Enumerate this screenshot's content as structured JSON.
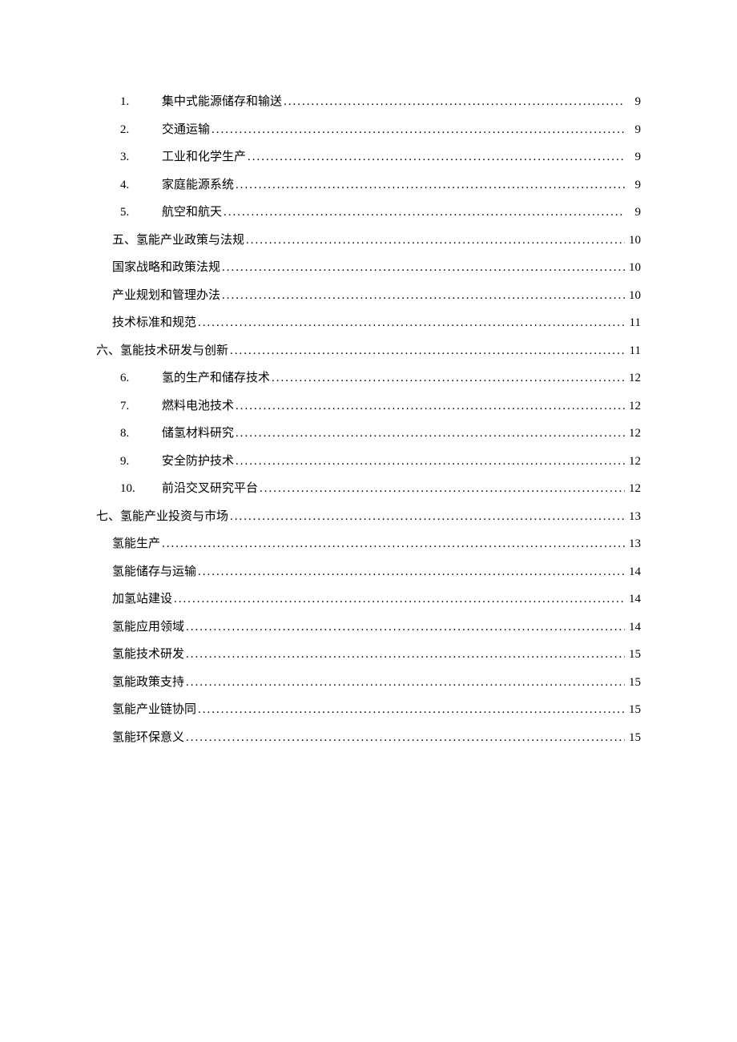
{
  "entries": [
    {
      "indent": 2,
      "num": "1.",
      "title": "集中式能源储存和输送",
      "page": "9"
    },
    {
      "indent": 2,
      "num": "2.",
      "title": "交通运输",
      "page": "9"
    },
    {
      "indent": 2,
      "num": "3.",
      "title": "工业和化学生产",
      "page": "9"
    },
    {
      "indent": 2,
      "num": "4.",
      "title": "家庭能源系统",
      "page": "9"
    },
    {
      "indent": 2,
      "num": "5.",
      "title": "航空和航天",
      "page": "9"
    },
    {
      "indent": 1,
      "num": "",
      "title": "五、氢能产业政策与法规",
      "page": "10"
    },
    {
      "indent": 1,
      "num": "",
      "title": "国家战略和政策法规",
      "page": "10"
    },
    {
      "indent": 1,
      "num": "",
      "title": "产业规划和管理办法",
      "page": "10"
    },
    {
      "indent": 1,
      "num": "",
      "title": "技术标准和规范",
      "page": "11"
    },
    {
      "indent": 0,
      "num": "",
      "title": "六、氢能技术研发与创新",
      "page": "11"
    },
    {
      "indent": 2,
      "num": "6.",
      "title": "氢的生产和储存技术",
      "page": "12"
    },
    {
      "indent": 2,
      "num": "7.",
      "title": "燃料电池技术",
      "page": "12"
    },
    {
      "indent": 2,
      "num": "8.",
      "title": "储氢材料研究",
      "page": "12"
    },
    {
      "indent": 2,
      "num": "9.",
      "title": "安全防护技术",
      "page": "12"
    },
    {
      "indent": 2,
      "num": "10.",
      "title": "前沿交叉研究平台",
      "page": "12"
    },
    {
      "indent": 0,
      "num": "",
      "title": "七、氢能产业投资与市场",
      "page": "13"
    },
    {
      "indent": 1,
      "num": "",
      "title": "氢能生产",
      "page": "13"
    },
    {
      "indent": 1,
      "num": "",
      "title": "氢能储存与运输",
      "page": "14"
    },
    {
      "indent": 1,
      "num": "",
      "title": "加氢站建设",
      "page": "14"
    },
    {
      "indent": 1,
      "num": "",
      "title": "氢能应用领域",
      "page": "14"
    },
    {
      "indent": 1,
      "num": "",
      "title": "氢能技术研发",
      "page": "15"
    },
    {
      "indent": 1,
      "num": "",
      "title": "氢能政策支持",
      "page": "15"
    },
    {
      "indent": 1,
      "num": "",
      "title": "氢能产业链协同",
      "page": "15"
    },
    {
      "indent": 1,
      "num": "",
      "title": "氢能环保意义",
      "page": "15"
    }
  ]
}
